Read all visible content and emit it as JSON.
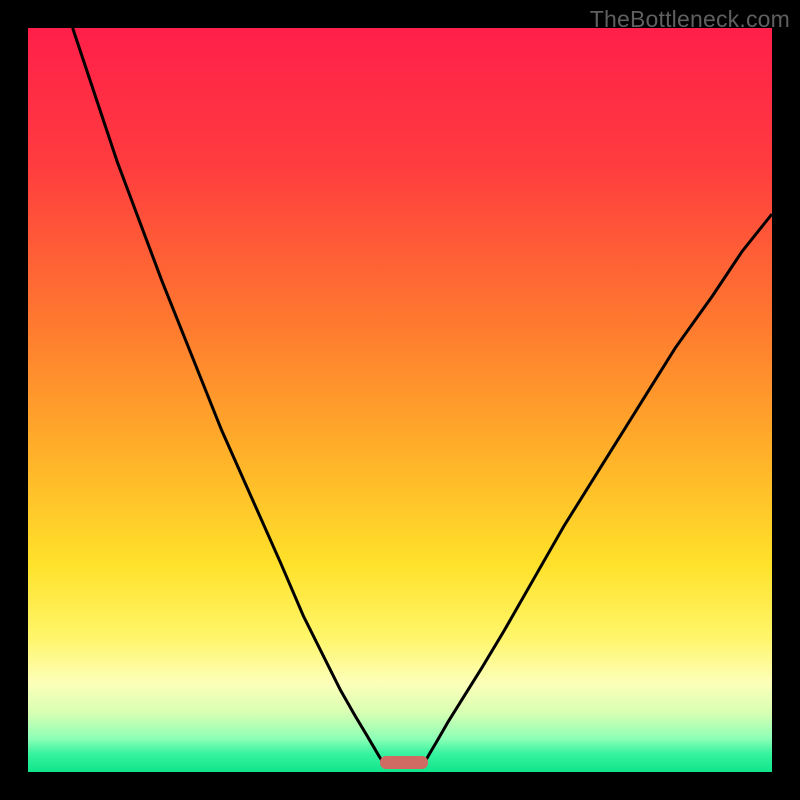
{
  "watermark": "TheBottleneck.com",
  "chart_data": {
    "type": "line",
    "title": "",
    "xlabel": "",
    "ylabel": "",
    "xlim": [
      0,
      100
    ],
    "ylim": [
      0,
      100
    ],
    "gradient_stops": [
      {
        "offset": 0,
        "color": "#ff1f4a"
      },
      {
        "offset": 18,
        "color": "#ff3b3f"
      },
      {
        "offset": 40,
        "color": "#ff7a2f"
      },
      {
        "offset": 58,
        "color": "#ffb329"
      },
      {
        "offset": 72,
        "color": "#ffe12a"
      },
      {
        "offset": 82,
        "color": "#fff66a"
      },
      {
        "offset": 88,
        "color": "#fdffb9"
      },
      {
        "offset": 92,
        "color": "#d8ffb3"
      },
      {
        "offset": 95.5,
        "color": "#8dffb6"
      },
      {
        "offset": 97.5,
        "color": "#38f3a0"
      },
      {
        "offset": 100,
        "color": "#0fe58b"
      }
    ],
    "series": [
      {
        "name": "left-curve",
        "x": [
          6,
          8,
          10,
          12,
          15,
          18,
          22,
          26,
          30,
          34,
          37,
          40,
          42,
          44,
          45.5,
          46.5,
          47.2,
          47.8,
          48.3
        ],
        "y": [
          100,
          94,
          88,
          82,
          74,
          66,
          56,
          46,
          37,
          28,
          21,
          15,
          11,
          7.5,
          5,
          3.3,
          2.1,
          1.2,
          0.6
        ]
      },
      {
        "name": "right-curve",
        "x": [
          52.8,
          53.3,
          54,
          55,
          56.5,
          58.5,
          61,
          64,
          68,
          72,
          77,
          82,
          87,
          92,
          96,
          100
        ],
        "y": [
          0.6,
          1.3,
          2.5,
          4.2,
          6.8,
          10,
          14,
          19,
          26,
          33,
          41,
          49,
          57,
          64,
          70,
          75
        ]
      }
    ],
    "marker": {
      "x_center": 50.5,
      "width_pct": 6.5,
      "y_bottom_pct": 98.7,
      "color": "#cf6b63"
    }
  }
}
